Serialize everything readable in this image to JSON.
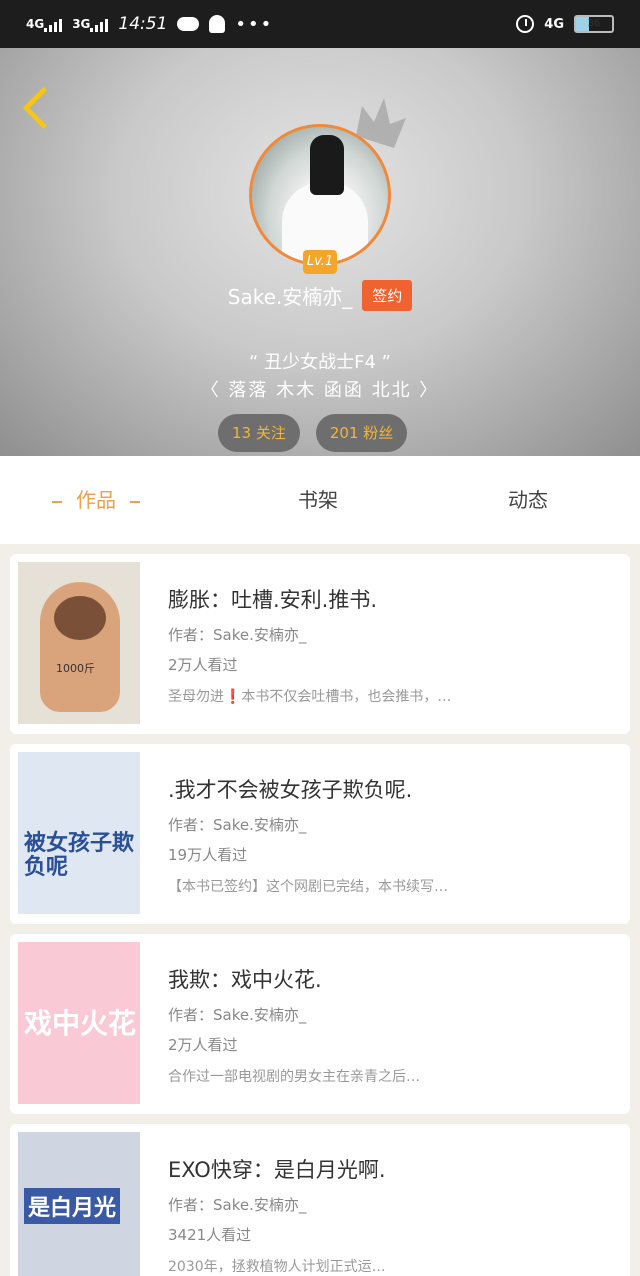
{
  "status_bar": {
    "signal1": "4G",
    "signal2": "3G",
    "time": "14:51",
    "network": "4G",
    "battery": "36"
  },
  "profile": {
    "level": "Lv.1",
    "username": "Sake.安楠亦_",
    "tag": "签约",
    "motto": "“ 丑少女战士F4 ”",
    "friends": "〈 落落 木木 函函 北北 〉",
    "following": "13 关注",
    "followers": "201 粉丝"
  },
  "tabs": [
    {
      "label": "作品"
    },
    {
      "label": "书架"
    },
    {
      "label": "动态"
    }
  ],
  "works": [
    {
      "title": "膨胀：吐槽.安利.推书.",
      "author": "作者：Sake.安楠亦_",
      "reads": "2万人看过",
      "desc": "圣母勿进❗本书不仅会吐槽书，也会推书，…",
      "cover_text": "1000斤"
    },
    {
      "title": ".我才不会被女孩子欺负呢.",
      "author": "作者：Sake.安楠亦_",
      "reads": "19万人看过",
      "desc": "【本书已签约】这个网剧已完结，本书续写…",
      "cover_text": "被女孩子欺负呢"
    },
    {
      "title": "我欺：戏中火花.",
      "author": "作者：Sake.安楠亦_",
      "reads": "2万人看过",
      "desc": "合作过一部电视剧的男女主在亲青之后…",
      "cover_text": "戏中火花"
    },
    {
      "title": "EXO快穿：是白月光啊.",
      "author": "作者：Sake.安楠亦_",
      "reads": "3421人看过",
      "desc": "2030年，拯救植物人计划正式运…",
      "cover_text": "是白月光"
    }
  ]
}
